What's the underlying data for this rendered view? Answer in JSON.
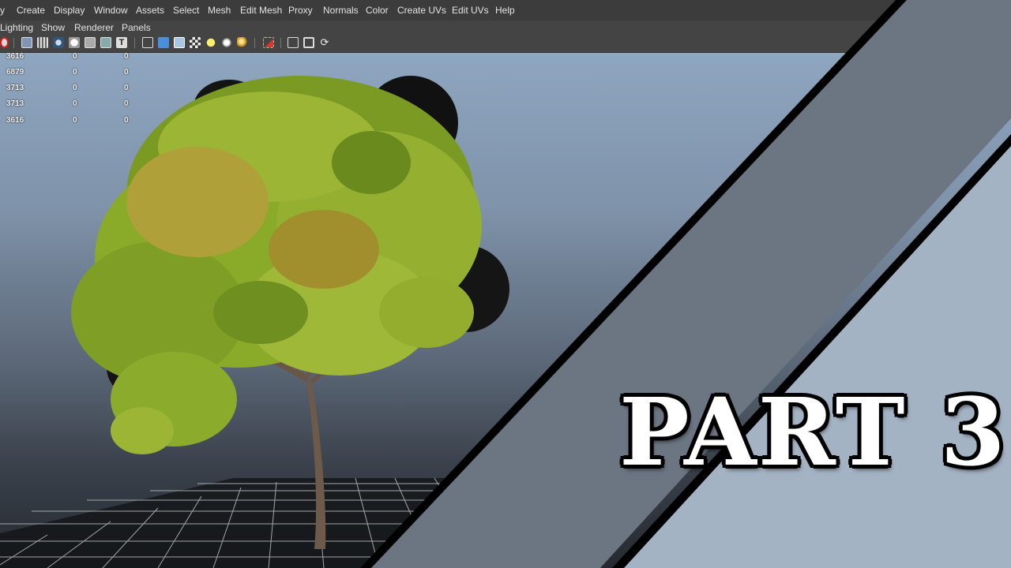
{
  "menubar": {
    "items": [
      "y",
      "Create",
      "Display",
      "Window",
      "Assets",
      "Select",
      "Mesh",
      "Edit Mesh",
      "Proxy",
      "Normals",
      "Color",
      "Create UVs",
      "Edit UVs",
      "Help"
    ]
  },
  "panel_menu": {
    "items": [
      "Lighting",
      "Show",
      "Renderer",
      "Panels"
    ]
  },
  "toolbar": {
    "icons": [
      "camera-icon",
      "wireframe-icon",
      "grid-icon",
      "smooth-shade-icon",
      "flat-shade-icon",
      "xray-icon",
      "isolate-icon",
      "text-icon",
      "wireframe-cube-icon",
      "shaded-cube-icon",
      "cube-icon",
      "checker-texture-icon",
      "light-bulb-icon",
      "default-light-icon",
      "gold-sphere-icon",
      "select-tool-icon",
      "box-icon",
      "frame-icon",
      "share-icon"
    ]
  },
  "hud": {
    "rows": [
      [
        "3616",
        "0",
        "0"
      ],
      [
        "6879",
        "0",
        "0"
      ],
      [
        "3713",
        "0",
        "0"
      ],
      [
        "3713",
        "0",
        "0"
      ],
      [
        "3616",
        "0",
        "0"
      ]
    ]
  },
  "title_overlay": {
    "text": "PART 3"
  },
  "colors": {
    "menubar_bg": "#3c3c3c",
    "viewport_top": "#8fa6c0",
    "viewport_bottom": "#262a30",
    "stripe_dark": "#6b7682",
    "stripe_light": "#a4b3c4",
    "foliage": "#8db52b"
  }
}
